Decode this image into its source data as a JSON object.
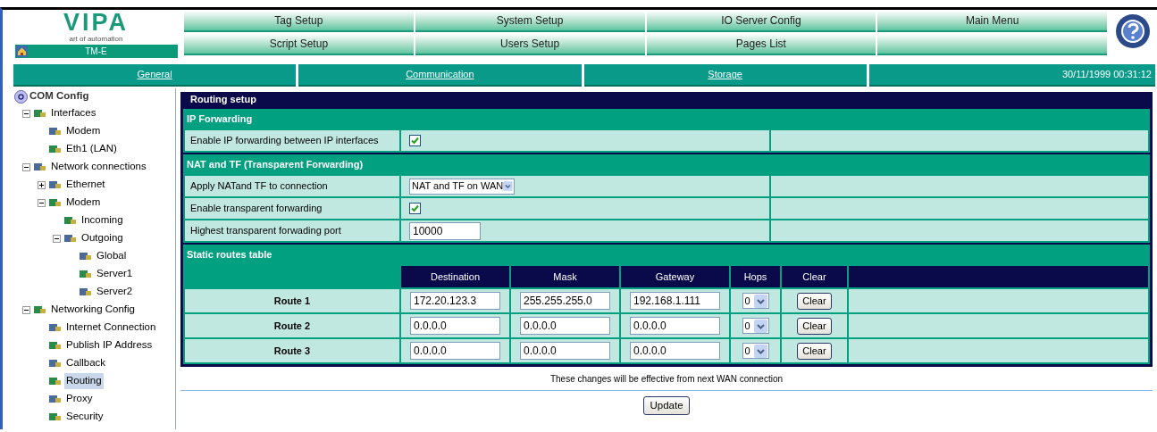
{
  "logo": {
    "brand": "VIPA",
    "tagline": "art of automation",
    "device": "TM-E"
  },
  "menu": [
    {
      "label": "Tag Setup"
    },
    {
      "label": "System Setup"
    },
    {
      "label": "IO Server Config"
    },
    {
      "label": "Main Menu"
    },
    {
      "label": "Script Setup"
    },
    {
      "label": "Users Setup"
    },
    {
      "label": "Pages List"
    }
  ],
  "tabs": [
    {
      "label": "General"
    },
    {
      "label": "Communication"
    },
    {
      "label": "Storage"
    }
  ],
  "datetime": "30/11/1999 00:31:12",
  "tree": {
    "label": "COM Config",
    "children": [
      {
        "label": "Interfaces",
        "expanded": true,
        "selected": false,
        "children": [
          {
            "label": "Modem",
            "selected": false
          },
          {
            "label": "Eth1 (LAN)",
            "selected": false
          }
        ]
      },
      {
        "label": "Network connections",
        "expanded": true,
        "selected": false,
        "children": [
          {
            "label": "Ethernet",
            "expanded": false,
            "selected": false
          },
          {
            "label": "Modem",
            "expanded": true,
            "selected": false,
            "children": [
              {
                "label": "Incoming",
                "selected": false
              },
              {
                "label": "Outgoing",
                "expanded": true,
                "selected": false,
                "children": [
                  {
                    "label": "Global",
                    "selected": false
                  },
                  {
                    "label": "Server1",
                    "selected": false
                  },
                  {
                    "label": "Server2",
                    "selected": false
                  }
                ]
              }
            ]
          }
        ]
      },
      {
        "label": "Networking Config",
        "expanded": true,
        "selected": false,
        "children": [
          {
            "label": "Internet Connection",
            "selected": false
          },
          {
            "label": "Publish IP Address",
            "selected": false
          },
          {
            "label": "Callback",
            "selected": false
          },
          {
            "label": "Routing",
            "selected": true
          },
          {
            "label": "Proxy",
            "selected": false
          },
          {
            "label": "Security",
            "selected": false
          }
        ]
      }
    ]
  },
  "panel": {
    "title": "Routing setup",
    "sections": [
      {
        "title": "IP Forwarding",
        "rows": [
          {
            "kind": "checkbox",
            "label": "Enable IP forwarding between IP interfaces",
            "checked": true
          }
        ]
      },
      {
        "title": "NAT and TF (Transparent Forwarding)",
        "rows": [
          {
            "kind": "select",
            "label": "Apply NATand TF to connection",
            "value": "NAT and TF on WAN"
          },
          {
            "kind": "checkbox",
            "label": "Enable transparent forwarding",
            "checked": true
          },
          {
            "kind": "text",
            "label": "Highest transparent forwading port",
            "value": "10000"
          }
        ]
      }
    ],
    "routes": {
      "title": "Static routes table",
      "columns": [
        "Destination",
        "Mask",
        "Gateway",
        "Hops",
        "Clear"
      ],
      "rows": [
        {
          "name": "Route 1",
          "destination": "172.20.123.3",
          "mask": "255.255.255.0",
          "gateway": "192.168.1.111",
          "hops": "0",
          "clear": "Clear"
        },
        {
          "name": "Route 2",
          "destination": "0.0.0.0",
          "mask": "0.0.0.0",
          "gateway": "0.0.0.0",
          "hops": "0",
          "clear": "Clear"
        },
        {
          "name": "Route 3",
          "destination": "0.0.0.0",
          "mask": "0.0.0.0",
          "gateway": "0.0.0.0",
          "hops": "0",
          "clear": "Clear"
        }
      ]
    }
  },
  "note": "These changes will be effective from next WAN connection",
  "update": "Update"
}
